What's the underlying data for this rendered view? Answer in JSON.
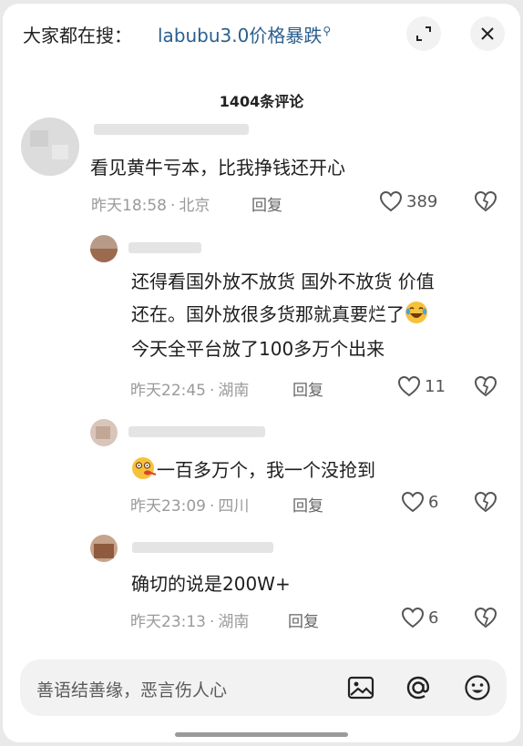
{
  "search": {
    "prefix": "大家都在搜：",
    "query": "labubu3.0价格暴跌",
    "icon": "search-icon"
  },
  "header": {
    "title": "1404条评论",
    "buttons": [
      "collapse-icon",
      "close-icon"
    ]
  },
  "comments": [
    {
      "text_lines": [
        "看见黄牛亏本，比我挣钱还开心"
      ],
      "time": "昨天18:58",
      "location": "北京",
      "reply_label": "回复",
      "likes": "389"
    },
    {
      "text_lines": [
        "还得看国外放不放货 国外不放货 价值",
        "还在。国外放很多货那就真要烂了",
        "今天全平台放了100多万个出来"
      ],
      "emoji": "laughing-crying-emoji",
      "time": "昨天22:45",
      "location": "湖南",
      "reply_label": "回复",
      "likes": "11"
    },
    {
      "text_lines": [
        "一百多万个，我一个没抢到"
      ],
      "emoji": "dizzy-face-emoji",
      "time": "昨天23:09",
      "location": "四川",
      "reply_label": "回复",
      "likes": "6"
    },
    {
      "text_lines": [
        "确切的说是200W+"
      ],
      "time": "昨天23:13",
      "location": "湖南",
      "reply_label": "回复",
      "likes": "6"
    }
  ],
  "input": {
    "placeholder": "善语结善缘，恶言伤人心",
    "icons": [
      "image-icon",
      "at-icon",
      "emoji-icon"
    ]
  },
  "colors": {
    "link": "#2b5f8e",
    "meta": "#9a9a9a",
    "background": "#ffffff"
  }
}
